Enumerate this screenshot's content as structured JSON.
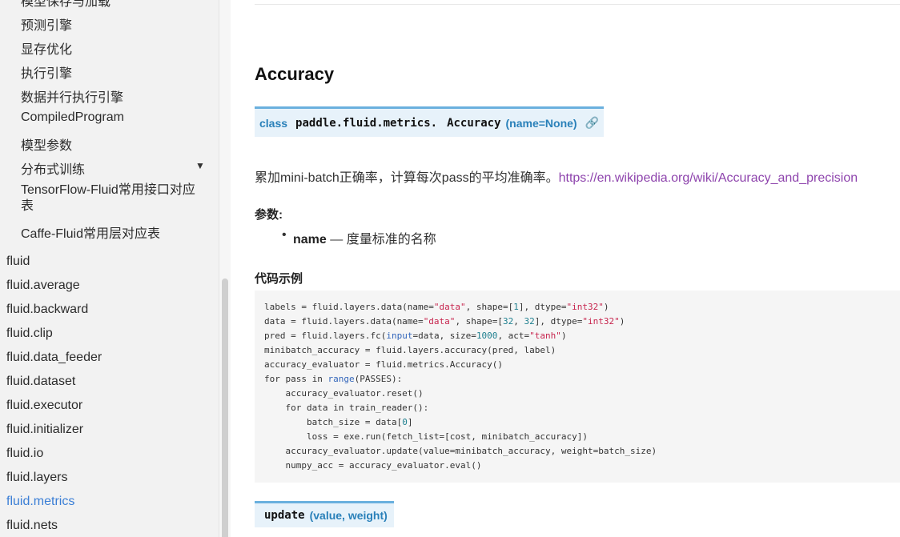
{
  "sidebar": {
    "sub_items": [
      "模型保存与加载",
      "预测引擎",
      "显存优化",
      "执行引擎",
      "数据并行执行引擎",
      "CompiledProgram",
      "模型参数",
      "分布式训练",
      "TensorFlow-Fluid常用接口对应表",
      "Caffe-Fluid常用层对应表"
    ],
    "caret": "▼",
    "top_items": [
      "fluid",
      "fluid.average",
      "fluid.backward",
      "fluid.clip",
      "fluid.data_feeder",
      "fluid.dataset",
      "fluid.executor",
      "fluid.initializer",
      "fluid.io",
      "fluid.layers",
      "fluid.metrics",
      "fluid.nets"
    ],
    "active_item": "fluid.metrics"
  },
  "main": {
    "title": "Accuracy",
    "signature": {
      "keyword": "class",
      "module": "paddle.fluid.metrics.",
      "name": "Accuracy",
      "params": "(name=None)",
      "link_icon": "🔗"
    },
    "description": "累加mini-batch正确率，计算每次pass的平均准确率。",
    "description_link": "https://en.wikipedia.org/wiki/Accuracy_and_precision",
    "params_label": "参数:",
    "param": {
      "name": "name",
      "text": " — 度量标准的名称"
    },
    "example_label": "代码示例",
    "code": [
      "labels = fluid.layers.data(name=\"data\", shape=[1], dtype=\"int32\")",
      "data = fluid.layers.data(name=\"data\", shape=[32, 32], dtype=\"int32\")",
      "pred = fluid.layers.fc(input=data, size=1000, act=\"tanh\")",
      "minibatch_accuracy = fluid.layers.accuracy(pred, label)",
      "accuracy_evaluator = fluid.metrics.Accuracy()",
      "for pass in range(PASSES):",
      "    accuracy_evaluator.reset()",
      "    for data in train_reader():",
      "        batch_size = data[0]",
      "        loss = exe.run(fetch_list=[cost, minibatch_accuracy])",
      "    accuracy_evaluator.update(value=minibatch_accuracy, weight=batch_size)",
      "    numpy_acc = accuracy_evaluator.eval()"
    ],
    "method": {
      "name": "update",
      "params": "(value, weight)"
    }
  },
  "colors": {
    "active_link": "#3b7fd6",
    "signature_bg": "#e7f2fa",
    "signature_border": "#6ab0de",
    "keyword": "#2980b9",
    "visited_link": "#8e44ad",
    "string": "#c7254e"
  }
}
